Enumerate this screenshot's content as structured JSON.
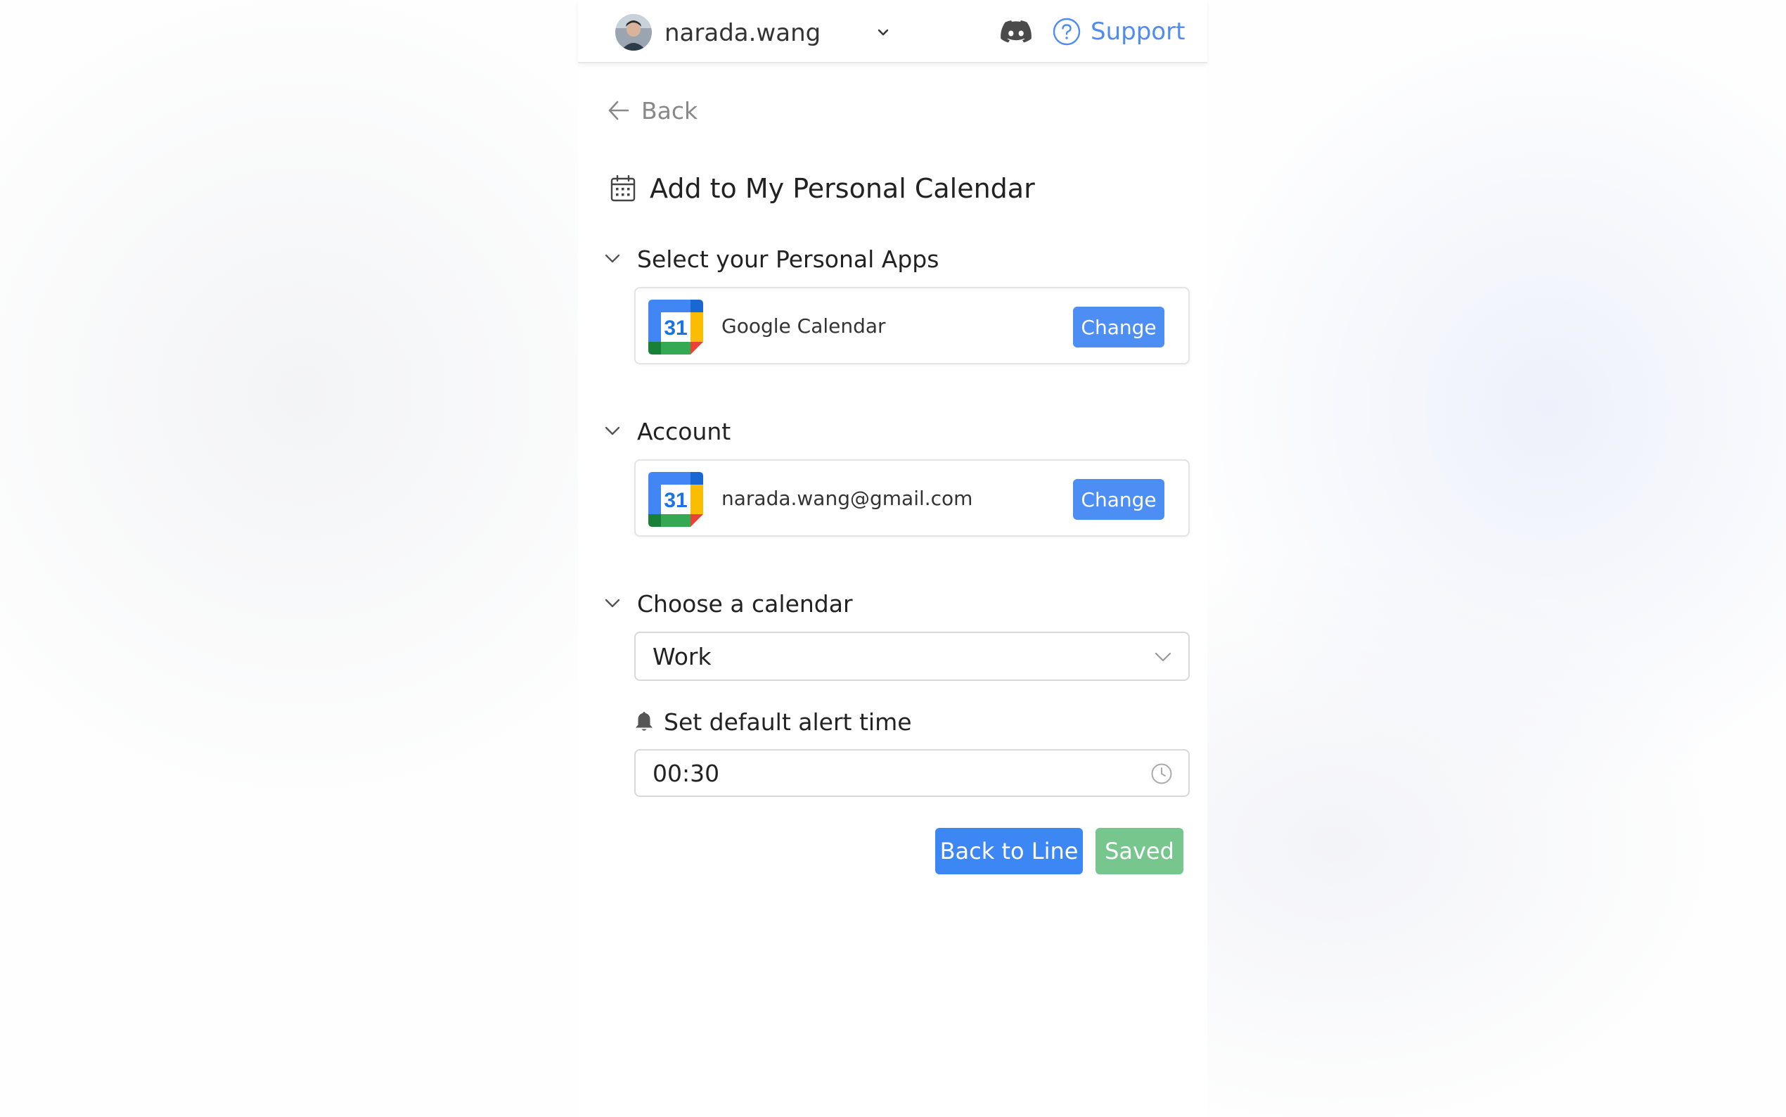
{
  "header": {
    "username": "narada.wang",
    "support_label": "Support"
  },
  "nav": {
    "back_label": "Back"
  },
  "page": {
    "title": "Add to My Personal Calendar"
  },
  "sections": {
    "apps": {
      "heading": "Select your Personal Apps",
      "app_name": "Google Calendar",
      "icon_number": "31",
      "change_label": "Change"
    },
    "account": {
      "heading": "Account",
      "email": "narada.wang@gmail.com",
      "icon_number": "31",
      "change_label": "Change"
    },
    "calendar": {
      "heading": "Choose a calendar",
      "selected": "Work",
      "alert_label": "Set default alert time",
      "alert_time": "00:30"
    }
  },
  "actions": {
    "back_to_line_label": "Back to Line",
    "saved_label": "Saved"
  },
  "colors": {
    "primary": "#3d87f5",
    "change_button": "#4d8ef5",
    "saved": "#76c68d",
    "support_link": "#4e8cf4"
  },
  "icons": {
    "avatar": "avatar",
    "user_menu": "chevron-down-icon",
    "discord": "discord-icon",
    "support": "question-circle-icon",
    "back": "arrow-left-icon",
    "title": "calendar-icon",
    "section_toggle": "chevron-down-icon",
    "app": "google-calendar-icon",
    "select": "chevron-down-icon",
    "alert": "bell-icon",
    "time": "clock-icon"
  }
}
